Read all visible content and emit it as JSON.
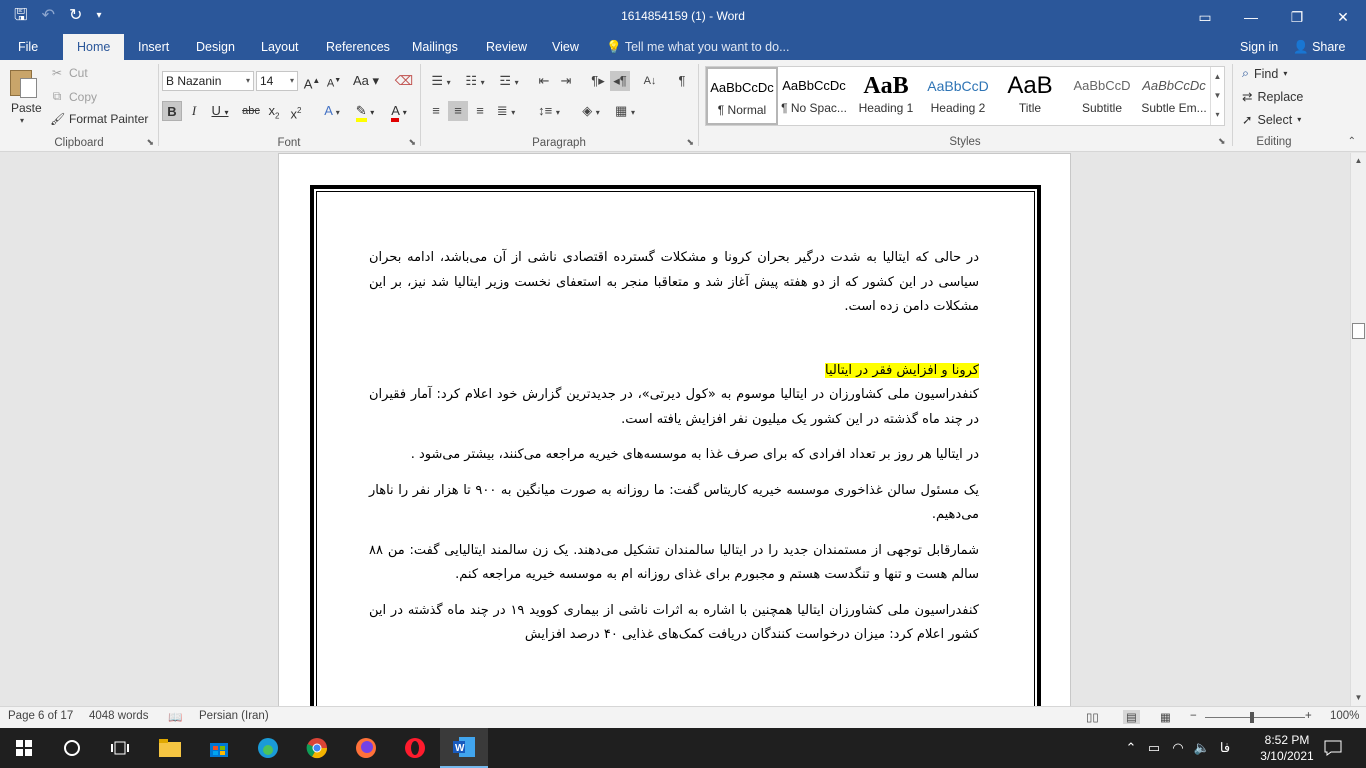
{
  "window": {
    "title": "1614854159 (1) - Word"
  },
  "tabs": {
    "file": "File",
    "home": "Home",
    "insert": "Insert",
    "design": "Design",
    "layout": "Layout",
    "references": "References",
    "mailings": "Mailings",
    "review": "Review",
    "view": "View",
    "tell_me": "Tell me what you want to do...",
    "sign_in": "Sign in",
    "share": "Share"
  },
  "clipboard": {
    "paste": "Paste",
    "cut": "Cut",
    "copy": "Copy",
    "format_painter": "Format Painter",
    "label": "Clipboard"
  },
  "font": {
    "name": "B Nazanin",
    "size": "14",
    "label": "Font"
  },
  "paragraph": {
    "label": "Paragraph"
  },
  "styles": {
    "label": "Styles",
    "items": [
      {
        "preview": "AaBbCcDc",
        "name": "¶ Normal"
      },
      {
        "preview": "AaBbCcDc",
        "name": "¶ No Spac..."
      },
      {
        "preview": "AaB",
        "name": "Heading 1"
      },
      {
        "preview": "AaBbCcD",
        "name": "Heading 2"
      },
      {
        "preview": "AaB",
        "name": "Title"
      },
      {
        "preview": "AaBbCcD",
        "name": "Subtitle"
      },
      {
        "preview": "AaBbCcDc",
        "name": "Subtle Em..."
      }
    ]
  },
  "editing": {
    "find": "Find",
    "replace": "Replace",
    "select": "Select",
    "label": "Editing"
  },
  "document": {
    "p1": "در حالی که ایتالیا به شدت درگیر بحران کرونا و مشکلات گسترده اقتصادی ناشی از آن می‌باشد، ادامه بحران سیاسی در این کشور که از دو هفته پیش آغاز شد و متعاقبا منجر به استعفای نخست وزیر ایتالیا شد نیز، بر این مشکلات دامن زده است.",
    "heading": "کرونا و افزایش فقر در ایتالیا",
    "p2": "کنفدراسیون ملی کشاورزان در ایتالیا موسوم به «کول دیرتی»، در جدیدترین گزارش خود اعلام کرد: آمار فقیران در چند ماه گذشته در این کشور یک میلیون نفر افزایش یافته است.",
    "p3": "در ایتالیا هر روز بر تعداد افرادی که برای صرف غذا به موسسه‌های خیریه مراجعه می‌کنند، بیشتر می‌شود .",
    "p4": "یک مسئول سالن غذاخوری موسسه خیریه کاریتاس گفت: ما روزانه به صورت میانگین به ۹۰۰ تا هزار نفر را ناهار می‌دهیم.",
    "p5": "شمارقابل توجهی از مستمندان جدید را در ایتالیا سالمندان تشکیل می‌دهند. یک زن سالمند ایتالیایی گفت: من ۸۸ سالم هست و تنها و تنگدست هستم و مجبورم برای غذای روزانه ام به موسسه خیریه مراجعه کنم.",
    "p6": "کنفدراسیون ملی کشاورزان ایتالیا همچنین با اشاره به اثرات ناشی از بیماری کووید ۱۹ در چند ماه گذشته در این کشور اعلام کرد: میزان درخواست کنندگان دریافت کمک‌های غذایی ۴۰ درصد افزایش"
  },
  "status": {
    "page": "Page 6 of 17",
    "words": "4048 words",
    "language": "Persian (Iran)",
    "zoom": "100%",
    "zoom_level_percent": 100
  },
  "taskbar": {
    "time": "8:52 PM",
    "date": "3/10/2021",
    "lang": "فا"
  }
}
